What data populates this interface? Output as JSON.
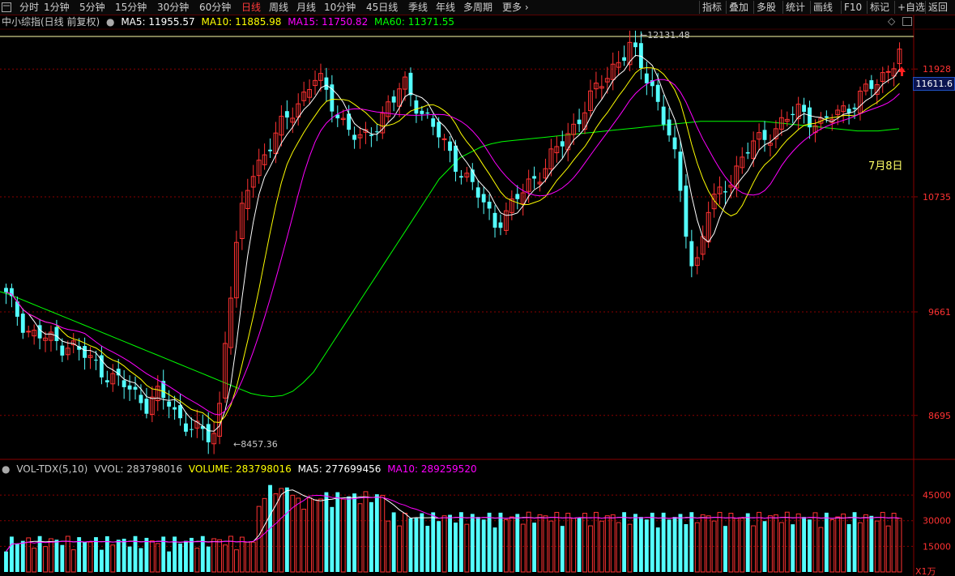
{
  "toolbar": {
    "icon": "window-menu-icon",
    "periods": [
      "分时",
      "1分钟",
      "5分钟",
      "15分钟",
      "30分钟",
      "60分钟",
      "日线",
      "周线",
      "月线",
      "10分钟",
      "45日线",
      "季线",
      "年线",
      "多周期",
      "更多"
    ],
    "active_period": "日线",
    "right_buttons": [
      "指标",
      "叠加",
      "多股",
      "统计",
      "画线",
      "F10",
      "标记",
      "+自选",
      "返回"
    ]
  },
  "header": {
    "title": "中小综指(日线 前复权)",
    "ma_labels": [
      "MA5: 11955.57",
      "MA10: 11885.98",
      "MA15: 11750.82",
      "MA60: 11371.55"
    ]
  },
  "price_badge": "11611.6",
  "price_axis": {
    "ticks": [
      "11928",
      "10735",
      "9661",
      "8695"
    ]
  },
  "annotations": {
    "high_label": "12131.48",
    "low_label": "8457.36",
    "date_note": "7月8日"
  },
  "volume_header": {
    "labels": [
      "VOL-TDX(5,10)",
      "VVOL: 283798016",
      "VOLUME: 283798016",
      "MA5: 277699456",
      "MA10: 289259520"
    ]
  },
  "volume_axis": {
    "ticks": [
      "45000",
      "30000",
      "15000"
    ],
    "unit": "X1万"
  },
  "colors": {
    "up": "#ff3232",
    "down": "#54ffff",
    "ma5": "#ffffff",
    "ma10": "#ffff00",
    "ma15": "#ff00ff",
    "ma60": "#00ff00",
    "grid": "#8a0000",
    "axis_text": "#ff3232"
  },
  "chart_data": {
    "type": "candlestick",
    "title": "中小综指(日线 前复权)",
    "price_range": [
      8300,
      12300
    ],
    "volume_range_wan": [
      0,
      55000
    ],
    "labeled_high": 12131.48,
    "labeled_low": 8457.36,
    "close_trend": [
      9800,
      9700,
      9600,
      9500,
      9450,
      9420,
      9400,
      9380,
      9350,
      9380,
      9300,
      9250,
      9200,
      9150,
      9100,
      9050,
      9000,
      8950,
      8900,
      8850,
      8800,
      8900,
      8850,
      8800,
      8700,
      8650,
      8600,
      8550,
      8500,
      8460,
      8700,
      9500,
      10000,
      10500,
      10800,
      11000,
      11100,
      11200,
      11300,
      11400,
      11500,
      11600,
      11700,
      11800,
      11850,
      11700,
      11600,
      11500,
      11400,
      11300,
      11250,
      11300,
      11400,
      11500,
      11600,
      11650,
      11800,
      11700,
      11600,
      11500,
      11400,
      11300,
      11200,
      11100,
      11000,
      10900,
      10800,
      10700,
      10600,
      10500,
      10550,
      10600,
      10700,
      10800,
      10900,
      10950,
      11000,
      11100,
      11200,
      11300,
      11400,
      11500,
      11600,
      11700,
      11800,
      11900,
      12000,
      12050,
      12131,
      12000,
      11900,
      11800,
      11600,
      11400,
      11200,
      10800,
      10400,
      10000,
      10300,
      10600,
      10700,
      10800,
      10900,
      11000,
      11100,
      11200,
      11250,
      11300,
      11350,
      11400,
      11450,
      11500,
      11550,
      11500,
      11450,
      11400,
      11450,
      11500,
      11550,
      11600,
      11650,
      11700,
      11750,
      11800,
      11900,
      12000,
      12100
    ],
    "ma60_trend": [
      9850,
      9820,
      9780,
      9740,
      9700,
      9660,
      9620,
      9580,
      9540,
      9500,
      9460,
      9420,
      9380,
      9340,
      9300,
      9260,
      9220,
      9180,
      9140,
      9100,
      9060,
      9020,
      8980,
      8940,
      8900,
      8880,
      8870,
      8880,
      8920,
      9000,
      9100,
      9250,
      9400,
      9550,
      9700,
      9850,
      10000,
      10150,
      10300,
      10450,
      10600,
      10750,
      10900,
      11000,
      11100,
      11150,
      11200,
      11230,
      11250,
      11260,
      11270,
      11280,
      11290,
      11300,
      11310,
      11320,
      11330,
      11340,
      11350,
      11360,
      11370,
      11380,
      11390,
      11400,
      11410,
      11420,
      11430,
      11440,
      11440,
      11440,
      11440,
      11440,
      11440,
      11440,
      11430,
      11420,
      11410,
      11400,
      11390,
      11380,
      11370,
      11360,
      11350,
      11350,
      11350,
      11360,
      11371
    ]
  }
}
